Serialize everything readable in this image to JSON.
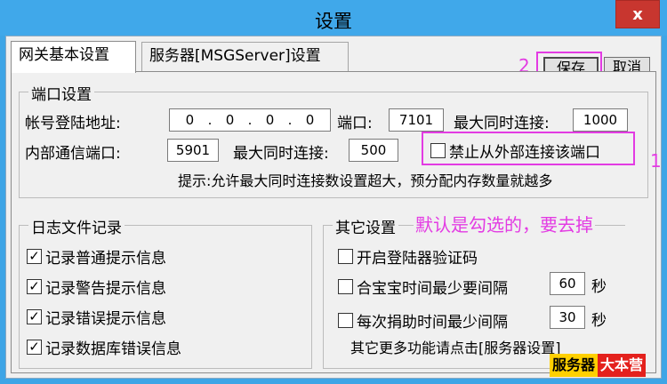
{
  "window": {
    "title": "设置",
    "close_glyph": "x"
  },
  "tabs": [
    {
      "label": "网关基本设置"
    },
    {
      "label": "服务器[MSGServer]设置"
    }
  ],
  "toolbar": {
    "save_label": "保存",
    "cancel_label": "取消"
  },
  "annotations": {
    "marker_1": "1",
    "marker_2": "2",
    "note": "默认是勾选的，要去掉",
    "color": "#e33be3"
  },
  "port_settings": {
    "title": "端口设置",
    "login_address_label": "帐号登陆地址:",
    "ip": [
      "0",
      "0",
      "0",
      "0"
    ],
    "port_label": "端口:",
    "port_value": "7101",
    "max_conn_label": "最大同时连接:",
    "max_conn_value": "1000",
    "internal_port_label": "内部通信端口:",
    "internal_port_value": "5901",
    "internal_max_conn_label": "最大同时连接:",
    "internal_max_conn_value": "500",
    "block_external_label": "禁止从外部连接该端口",
    "block_external_checked": false,
    "hint": "提示:允许最大同时连接数设置超大，预分配内存数量就越多"
  },
  "log_settings": {
    "title": "日志文件记录",
    "items": [
      {
        "label": "记录普通提示信息",
        "checked": true
      },
      {
        "label": "记录警告提示信息",
        "checked": true
      },
      {
        "label": "记录错误提示信息",
        "checked": true
      },
      {
        "label": "记录数据库错误信息",
        "checked": true
      }
    ]
  },
  "other_settings": {
    "title": "其它设置",
    "captcha_label": "开启登陆器验证码",
    "captcha_checked": false,
    "treasure_label": "合宝宝时间最少要间隔",
    "treasure_checked": false,
    "treasure_value": "60",
    "treasure_unit": "秒",
    "donate_label": "每次捐助时间最少间隔",
    "donate_checked": false,
    "donate_value": "30",
    "donate_unit": "秒",
    "more_hint": "其它更多功能请点击[服务器设置]"
  },
  "watermark": {
    "part_a": "服务器",
    "part_b": "大本营"
  }
}
